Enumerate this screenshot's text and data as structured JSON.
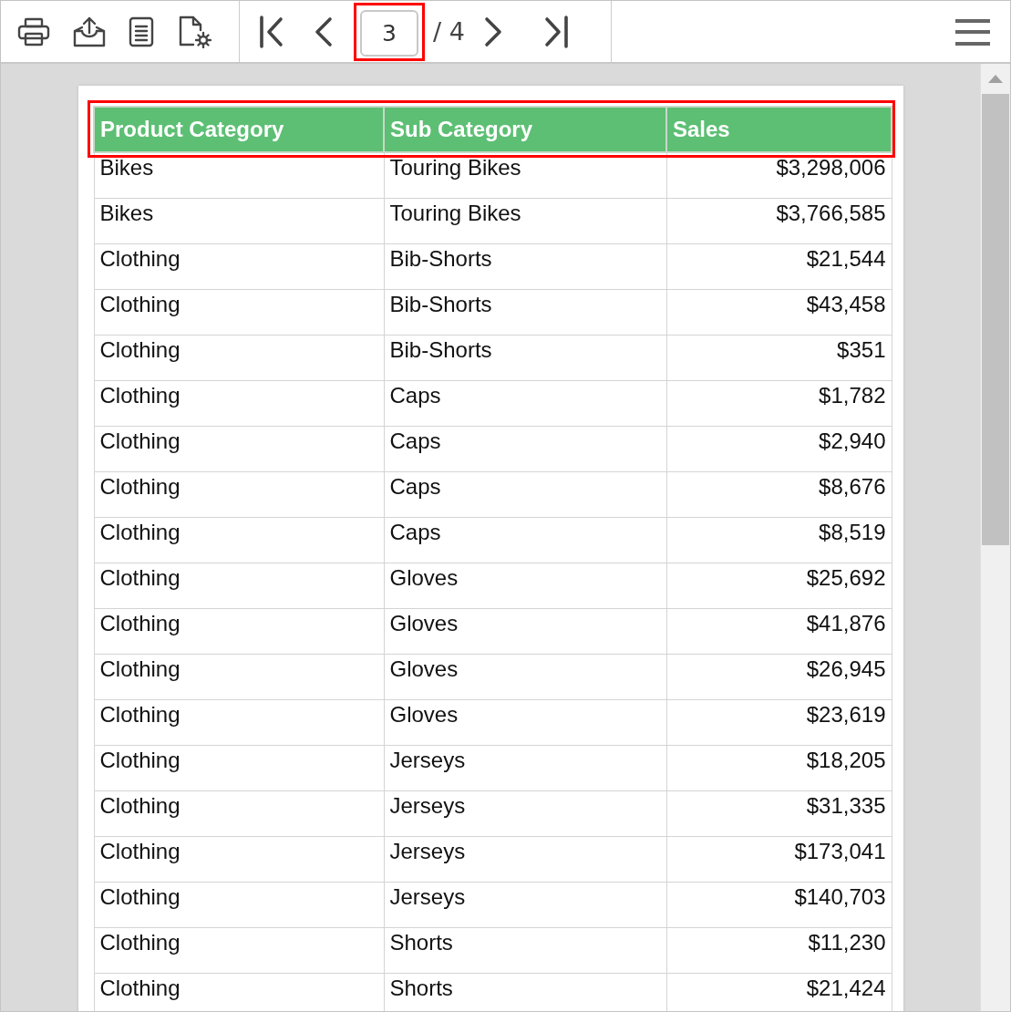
{
  "toolbar": {
    "page_field": {
      "value": "3",
      "highlighted": true
    },
    "page_total": "/ 4"
  },
  "table": {
    "header_highlighted": true,
    "columns": [
      {
        "label": "Product Category",
        "kind": "text"
      },
      {
        "label": "Sub Category",
        "kind": "text"
      },
      {
        "label": "Sales",
        "kind": "number"
      }
    ],
    "rows": [
      [
        "Bikes",
        "Touring Bikes",
        "$3,298,006"
      ],
      [
        "Bikes",
        "Touring Bikes",
        "$3,766,585"
      ],
      [
        "Clothing",
        "Bib-Shorts",
        "$21,544"
      ],
      [
        "Clothing",
        "Bib-Shorts",
        "$43,458"
      ],
      [
        "Clothing",
        "Bib-Shorts",
        "$351"
      ],
      [
        "Clothing",
        "Caps",
        "$1,782"
      ],
      [
        "Clothing",
        "Caps",
        "$2,940"
      ],
      [
        "Clothing",
        "Caps",
        "$8,676"
      ],
      [
        "Clothing",
        "Caps",
        "$8,519"
      ],
      [
        "Clothing",
        "Gloves",
        "$25,692"
      ],
      [
        "Clothing",
        "Gloves",
        "$41,876"
      ],
      [
        "Clothing",
        "Gloves",
        "$26,945"
      ],
      [
        "Clothing",
        "Gloves",
        "$23,619"
      ],
      [
        "Clothing",
        "Jerseys",
        "$18,205"
      ],
      [
        "Clothing",
        "Jerseys",
        "$31,335"
      ],
      [
        "Clothing",
        "Jerseys",
        "$173,041"
      ],
      [
        "Clothing",
        "Jerseys",
        "$140,703"
      ],
      [
        "Clothing",
        "Shorts",
        "$11,230"
      ],
      [
        "Clothing",
        "Shorts",
        "$21,424"
      ]
    ]
  }
}
